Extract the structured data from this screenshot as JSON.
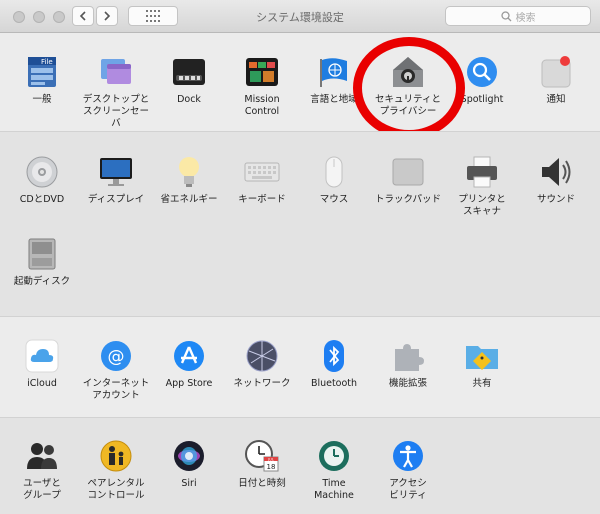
{
  "window": {
    "title": "システム環境設定"
  },
  "search": {
    "placeholder": "検索"
  },
  "rows": {
    "personal": [
      {
        "label": "一般"
      },
      {
        "label": "デスクトップと\nスクリーンセーバ"
      },
      {
        "label": "Dock"
      },
      {
        "label": "Mission\nControl"
      },
      {
        "label": "言語と地域"
      },
      {
        "label": "セキュリティと\nプライバシー"
      },
      {
        "label": "Spotlight"
      },
      {
        "label": "通知"
      }
    ],
    "hardware": [
      {
        "label": "CDとDVD"
      },
      {
        "label": "ディスプレイ"
      },
      {
        "label": "省エネルギー"
      },
      {
        "label": "キーボード"
      },
      {
        "label": "マウス"
      },
      {
        "label": "トラックパッド"
      },
      {
        "label": "プリンタと\nスキャナ"
      },
      {
        "label": "サウンド"
      },
      {
        "label": "起動ディスク"
      }
    ],
    "internet": [
      {
        "label": "iCloud"
      },
      {
        "label": "インターネット\nアカウント"
      },
      {
        "label": "App Store"
      },
      {
        "label": "ネットワーク"
      },
      {
        "label": "Bluetooth"
      },
      {
        "label": "機能拡張"
      },
      {
        "label": "共有"
      }
    ],
    "system": [
      {
        "label": "ユーザと\nグループ"
      },
      {
        "label": "ペアレンタル\nコントロール"
      },
      {
        "label": "Siri"
      },
      {
        "label": "日付と時刻"
      },
      {
        "label": "Time\nMachine"
      },
      {
        "label": "アクセシ\nビリティ"
      }
    ]
  },
  "icons": {
    "general": "file-icon",
    "security": "house-lock-icon",
    "notifications": "notification-icon",
    "calendar_day": "18",
    "calendar_month": "JUL"
  },
  "colors": {
    "highlight_ring": "#e90000",
    "accent_blue": "#1a73e8"
  }
}
